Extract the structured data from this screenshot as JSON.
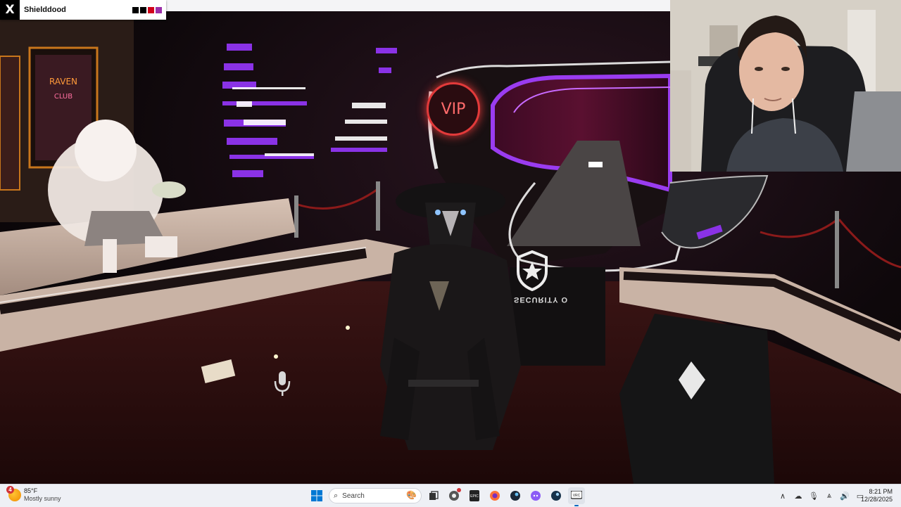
{
  "overlay": {
    "x_logo": "X",
    "username": "Shielddood",
    "swatch_colors": [
      "#000000",
      "#000000",
      "#d0021b",
      "#9b2fa8"
    ]
  },
  "scene": {
    "vip_sign": "VIP",
    "security_text": "SECURITY O"
  },
  "taskbar": {
    "weather": {
      "badge": "4",
      "temperature": "85°F",
      "condition": "Mostly sunny"
    },
    "search_placeholder": "Search",
    "pinned_apps": [
      "windows-start",
      "search",
      "task-view",
      "chrome",
      "epic-games",
      "firefox",
      "steam",
      "discord",
      "steam-vr",
      "vrchat"
    ],
    "clock": {
      "time": "8:21 PM",
      "date": "12/28/2025"
    },
    "colors": {
      "accent": "#0067c0",
      "taskbar_bg": "#eef0f5"
    }
  }
}
